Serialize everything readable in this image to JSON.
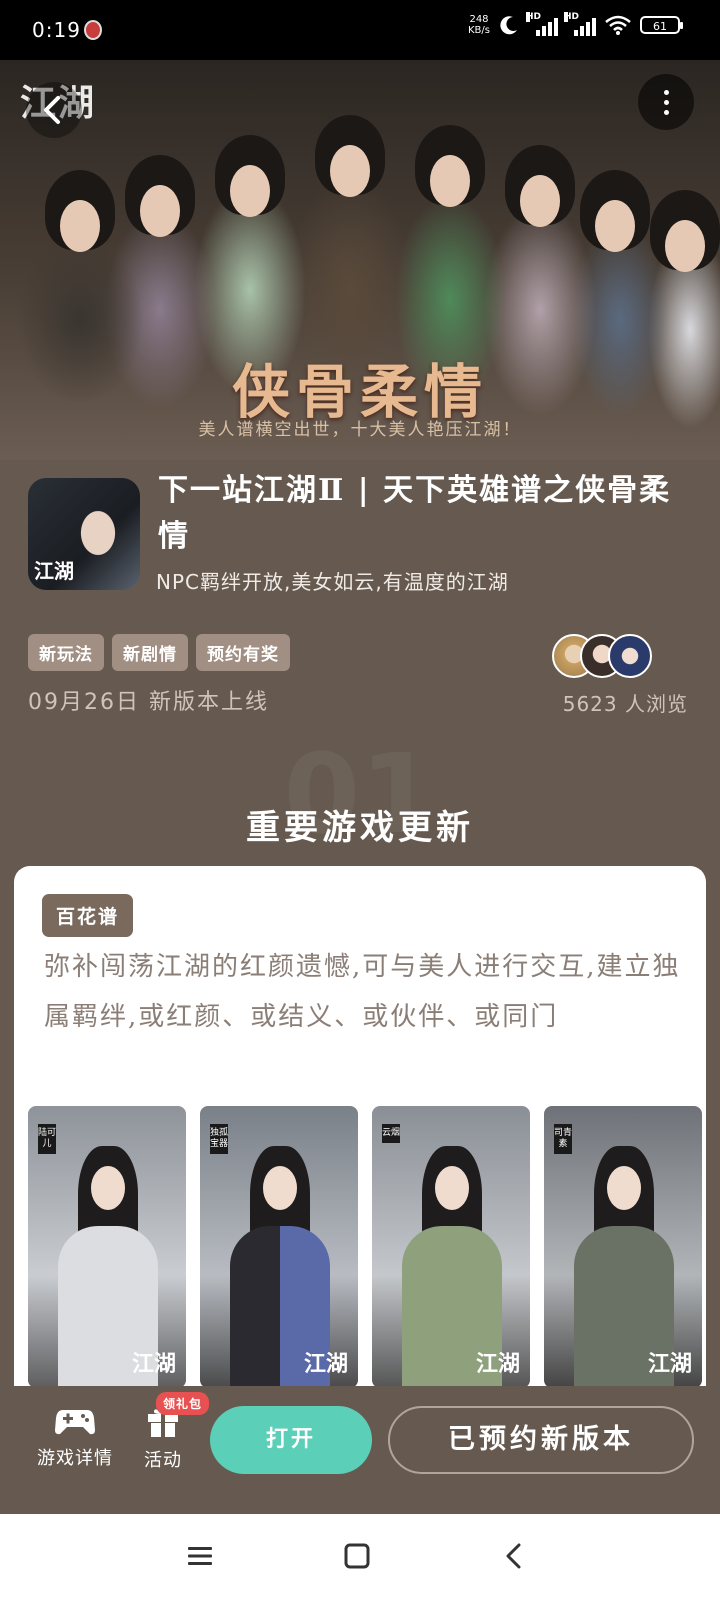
{
  "status_bar": {
    "time": "0:19",
    "net_speed_value": "248",
    "net_speed_unit": "KB/s",
    "hd1": "HD",
    "hd2": "HD",
    "battery": "61"
  },
  "banner": {
    "logo": "江湖",
    "title": "侠骨柔情",
    "subtitle": "美人谱横空出世，十大美人艳压江湖！"
  },
  "app": {
    "icon_text": "江湖",
    "name": "下一站江湖Ⅱ | 天下英雄谱之侠骨柔情",
    "description": "NPC羁绊开放,美女如云,有温度的江湖"
  },
  "tags": [
    "新玩法",
    "新剧情",
    "预约有奖"
  ],
  "release_text": "09月26日 新版本上线",
  "viewers_text": "5623 人浏览",
  "section": {
    "watermark": "01",
    "title": "重要游戏更新"
  },
  "card": {
    "tag": "百花谱",
    "text": "弥补闯荡江湖的红颜遗憾,可与美人进行交互,建立独属羁绊,或红颜、或结义、或伙伴、或同门",
    "characters": [
      {
        "name": "陆可儿",
        "logo": "江湖"
      },
      {
        "name": "独孤宝器",
        "logo": "江湖"
      },
      {
        "name": "云烟",
        "logo": "江湖"
      },
      {
        "name": "司青素",
        "logo": "江湖"
      }
    ]
  },
  "bottom_bar": {
    "game_details": "游戏详情",
    "activity": "活动",
    "gift_badge": "领礼包",
    "open": "打开",
    "reserved": "已预约新版本"
  },
  "colors": {
    "background": "#665a50",
    "open_button": "#5bcfb8",
    "tag": "#a08f82",
    "card_tag": "#7a6a5e",
    "badge": "#e85151"
  },
  "icons": [
    "back-icon",
    "more-vert-icon",
    "gamepad-icon",
    "gift-icon",
    "menu-icon",
    "home-square-icon",
    "back-chevron-icon"
  ]
}
